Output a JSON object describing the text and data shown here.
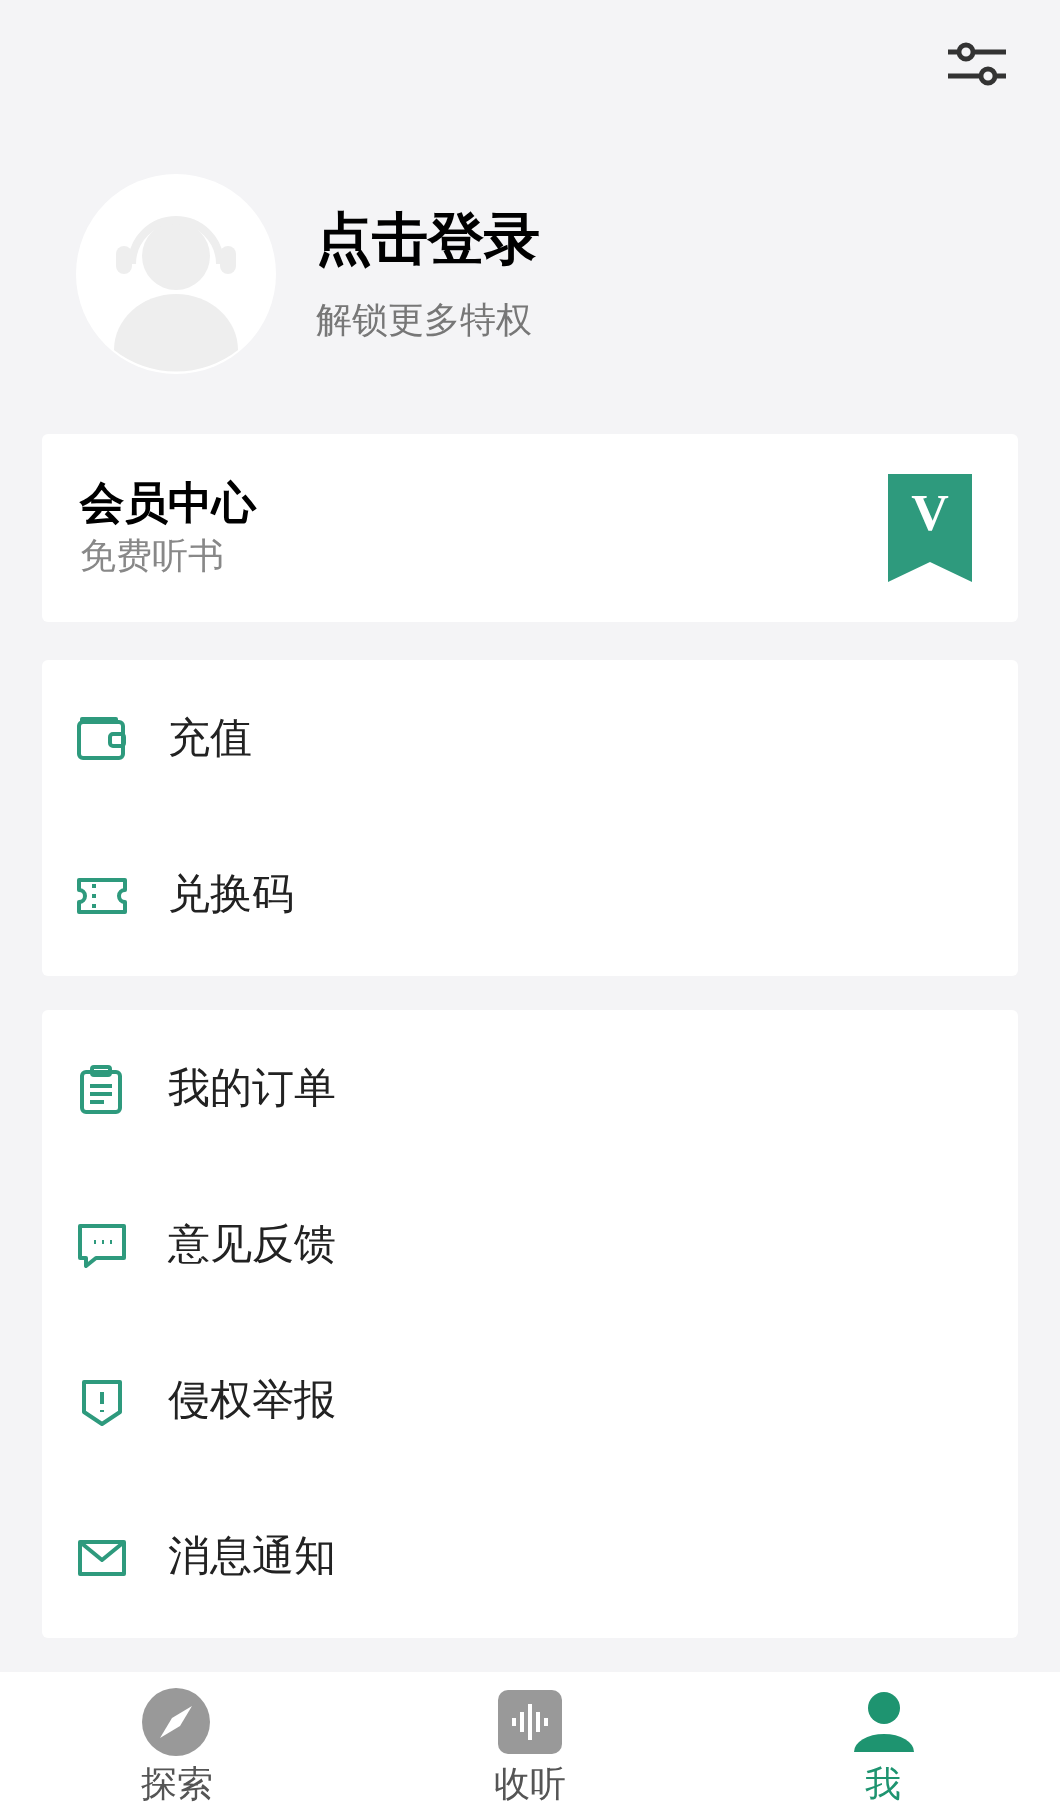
{
  "profile": {
    "title": "点击登录",
    "subtitle": "解锁更多特权"
  },
  "member_card": {
    "title": "会员中心",
    "subtitle": "免费听书",
    "badge": "V"
  },
  "menu_groups": [
    [
      {
        "label": "充值",
        "kind": "wallet"
      },
      {
        "label": "兑换码",
        "kind": "ticket"
      }
    ],
    [
      {
        "label": "我的订单",
        "kind": "clipboard"
      },
      {
        "label": "意见反馈",
        "kind": "chat"
      },
      {
        "label": "侵权举报",
        "kind": "shield"
      },
      {
        "label": "消息通知",
        "kind": "mail"
      }
    ]
  ],
  "tabs": [
    {
      "label": "探索",
      "kind": "compass",
      "selected": false
    },
    {
      "label": "收听",
      "kind": "audio",
      "selected": false
    },
    {
      "label": "我",
      "kind": "person",
      "selected": true
    }
  ]
}
